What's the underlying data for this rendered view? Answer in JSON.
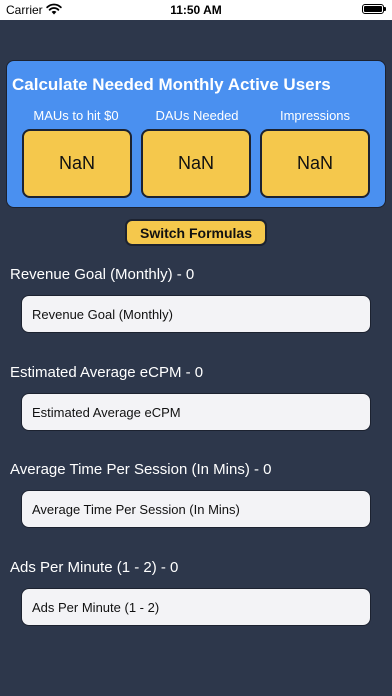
{
  "status_bar": {
    "carrier": "Carrier",
    "time": "11:50 AM",
    "icons": [
      "wifi-icon",
      "battery-icon"
    ]
  },
  "calculator": {
    "title": "Calculate Needed Monthly Active Users",
    "columns": [
      {
        "label": "MAUs to hit $0",
        "value": "NaN"
      },
      {
        "label": "DAUs Needed",
        "value": "NaN"
      },
      {
        "label": "Impressions",
        "value": "NaN"
      }
    ]
  },
  "switch_button": {
    "label": "Switch Formulas"
  },
  "fields": [
    {
      "label": "Revenue Goal (Monthly) - 0",
      "value": "",
      "placeholder": "Revenue Goal (Monthly)"
    },
    {
      "label": "Estimated Average eCPM - 0",
      "value": "",
      "placeholder": "Estimated Average eCPM"
    },
    {
      "label": "Average Time Per Session (In Mins) - 0",
      "value": "",
      "placeholder": "Average Time Per Session (In Mins)"
    },
    {
      "label": "Ads Per Minute (1 - 2) - 0",
      "value": "",
      "placeholder": "Ads Per Minute (1 - 2)"
    }
  ],
  "colors": {
    "background": "#2d374b",
    "card": "#4a90f0",
    "accent": "#f5c84c",
    "input": "#f3f3f6"
  }
}
